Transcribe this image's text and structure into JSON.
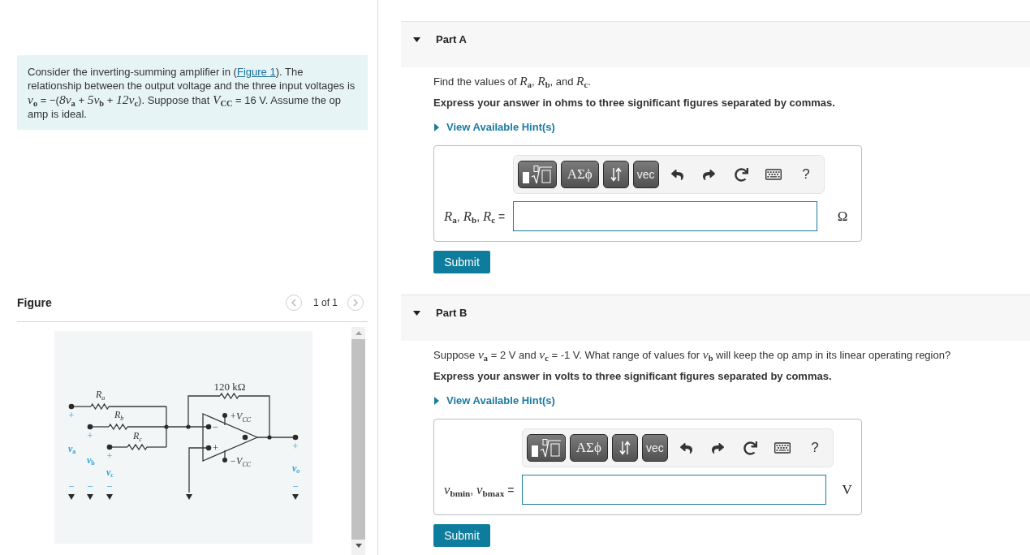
{
  "problem": {
    "before": "Consider the inverting-summing amplifier in (",
    "link": "Figure 1",
    "after": "). The relationship between the output voltage and the three input voltages is *v*$_{o}$ = −(*8v*$_{a}$ + *5v*$_{b}$ + *12v*$_{c}$). Suppose that *V*$_{CC}$ = 16 V. Assume the op amp is ideal."
  },
  "figure": {
    "title": "Figure",
    "pager": "1 of 1",
    "circuit": {
      "inputs": [
        {
          "resistor": "R",
          "resistor_sub": "a",
          "source": "v",
          "source_sub": "a",
          "plus": "+",
          "minus": "−"
        },
        {
          "resistor": "R",
          "resistor_sub": "b",
          "source": "v",
          "source_sub": "b",
          "plus": "+",
          "minus": "−"
        },
        {
          "resistor": "R",
          "resistor_sub": "c",
          "source": "v",
          "source_sub": "c",
          "plus": "+",
          "minus": "−"
        }
      ],
      "feedback": "120 kΩ",
      "inverting": "−",
      "noninverting": "+",
      "supply_pos": {
        "text": "+V",
        "sub": "CC"
      },
      "supply_neg": {
        "text": "−V",
        "sub": "CC"
      },
      "output": {
        "source": "v",
        "source_sub": "o",
        "plus": "+",
        "minus": "−"
      }
    }
  },
  "parts": [
    {
      "title": "Part A",
      "expanded": true,
      "prompt": "Find the values of *R*$_{a}$, *R*$_{b}$, and *R*$_{c}$.",
      "instruction": "Express your answer in ohms to three significant figures separated by commas.",
      "hint": {
        "label": "View Available Hint(s)",
        "expanded": false
      },
      "toolbar": {
        "symbols": "ΑΣϕ",
        "vector": "vec",
        "help": "?"
      },
      "answer": {
        "label": "*R*$_{a}$, *R*$_{b}$, *R*$_{c}$ =",
        "unit": "Ω"
      },
      "submit": "Submit"
    },
    {
      "title": "Part B",
      "expanded": true,
      "prompt": "Suppose *v*$_{a}$ = 2 V and *v*$_{c}$ = -1 V. What range of values for *v*$_{b}$ will keep the op amp in its linear operating region?",
      "instruction": "Express your answer in volts to three significant figures separated by commas.",
      "hint": {
        "label": "View Available Hint(s)",
        "expanded": false
      },
      "toolbar": {
        "symbols": "ΑΣϕ",
        "vector": "vec",
        "help": "?"
      },
      "answer": {
        "label": "*v*$_{bmin}$, *v*$_{bmax}$ =",
        "unit": "V"
      },
      "submit": "Submit"
    }
  ]
}
